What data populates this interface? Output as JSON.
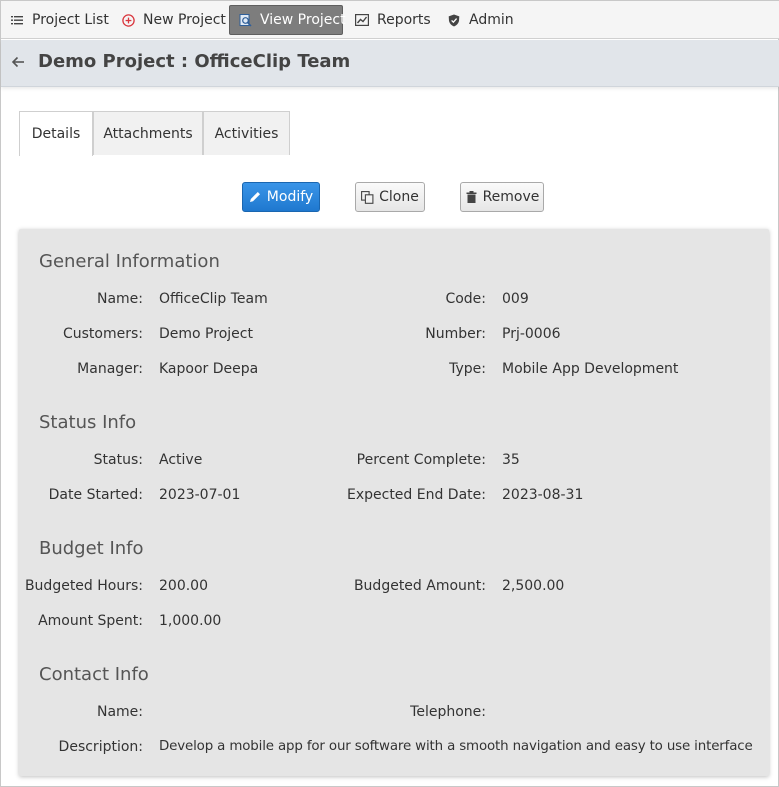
{
  "nav": {
    "project_list": "Project List",
    "new_project": "New Project",
    "view_project": "View Project",
    "reports": "Reports",
    "admin": "Admin"
  },
  "header": {
    "title": "Demo Project : OfficeClip Team"
  },
  "tabs": [
    {
      "label": "Details"
    },
    {
      "label": "Attachments"
    },
    {
      "label": "Activities"
    }
  ],
  "actions": {
    "modify": "Modify",
    "clone": "Clone",
    "remove": "Remove"
  },
  "general": {
    "title": "General Information",
    "name_label": "Name:",
    "name": "OfficeClip Team",
    "code_label": "Code:",
    "code": "009",
    "customers_label": "Customers:",
    "customers": "Demo Project",
    "number_label": "Number:",
    "number": "Prj-0006",
    "manager_label": "Manager:",
    "manager": "Kapoor Deepa",
    "type_label": "Type:",
    "type": "Mobile App Development"
  },
  "status": {
    "title": "Status Info",
    "status_label": "Status:",
    "status": "Active",
    "percent_label": "Percent Complete:",
    "percent": "35",
    "started_label": "Date Started:",
    "started": "2023-07-01",
    "end_label": "Expected End Date:",
    "end": "2023-08-31"
  },
  "budget": {
    "title": "Budget Info",
    "hours_label": "Budgeted Hours:",
    "hours": "200.00",
    "amount_label": "Budgeted Amount:",
    "amount": "2,500.00",
    "spent_label": "Amount Spent:",
    "spent": "1,000.00"
  },
  "contact": {
    "title": "Contact Info",
    "name_label": "Name:",
    "name": "",
    "telephone_label": "Telephone:",
    "telephone": "",
    "description_label": "Description:",
    "description": "Develop a mobile app for our software with a smooth navigation and easy to use interface"
  },
  "colors": {
    "primary": "#2a86dc",
    "active_nav": "#7d7d7d",
    "panel": "#e5e5e5",
    "header": "#e1e5ea"
  }
}
